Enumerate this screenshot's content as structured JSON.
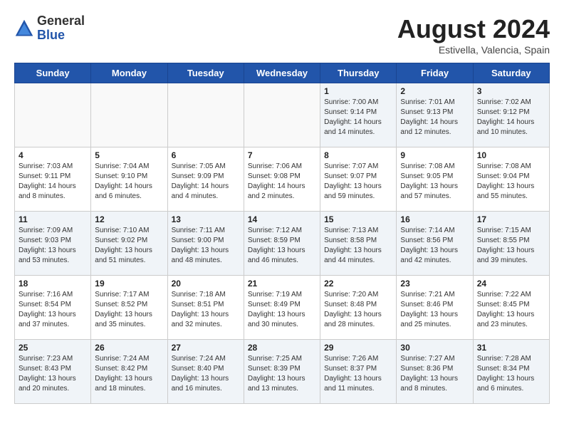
{
  "header": {
    "logo_general": "General",
    "logo_blue": "Blue",
    "month_year": "August 2024",
    "location": "Estivella, Valencia, Spain"
  },
  "days_of_week": [
    "Sunday",
    "Monday",
    "Tuesday",
    "Wednesday",
    "Thursday",
    "Friday",
    "Saturday"
  ],
  "weeks": [
    [
      {
        "day": "",
        "info": ""
      },
      {
        "day": "",
        "info": ""
      },
      {
        "day": "",
        "info": ""
      },
      {
        "day": "",
        "info": ""
      },
      {
        "day": "1",
        "info": "Sunrise: 7:00 AM\nSunset: 9:14 PM\nDaylight: 14 hours\nand 14 minutes."
      },
      {
        "day": "2",
        "info": "Sunrise: 7:01 AM\nSunset: 9:13 PM\nDaylight: 14 hours\nand 12 minutes."
      },
      {
        "day": "3",
        "info": "Sunrise: 7:02 AM\nSunset: 9:12 PM\nDaylight: 14 hours\nand 10 minutes."
      }
    ],
    [
      {
        "day": "4",
        "info": "Sunrise: 7:03 AM\nSunset: 9:11 PM\nDaylight: 14 hours\nand 8 minutes."
      },
      {
        "day": "5",
        "info": "Sunrise: 7:04 AM\nSunset: 9:10 PM\nDaylight: 14 hours\nand 6 minutes."
      },
      {
        "day": "6",
        "info": "Sunrise: 7:05 AM\nSunset: 9:09 PM\nDaylight: 14 hours\nand 4 minutes."
      },
      {
        "day": "7",
        "info": "Sunrise: 7:06 AM\nSunset: 9:08 PM\nDaylight: 14 hours\nand 2 minutes."
      },
      {
        "day": "8",
        "info": "Sunrise: 7:07 AM\nSunset: 9:07 PM\nDaylight: 13 hours\nand 59 minutes."
      },
      {
        "day": "9",
        "info": "Sunrise: 7:08 AM\nSunset: 9:05 PM\nDaylight: 13 hours\nand 57 minutes."
      },
      {
        "day": "10",
        "info": "Sunrise: 7:08 AM\nSunset: 9:04 PM\nDaylight: 13 hours\nand 55 minutes."
      }
    ],
    [
      {
        "day": "11",
        "info": "Sunrise: 7:09 AM\nSunset: 9:03 PM\nDaylight: 13 hours\nand 53 minutes."
      },
      {
        "day": "12",
        "info": "Sunrise: 7:10 AM\nSunset: 9:02 PM\nDaylight: 13 hours\nand 51 minutes."
      },
      {
        "day": "13",
        "info": "Sunrise: 7:11 AM\nSunset: 9:00 PM\nDaylight: 13 hours\nand 48 minutes."
      },
      {
        "day": "14",
        "info": "Sunrise: 7:12 AM\nSunset: 8:59 PM\nDaylight: 13 hours\nand 46 minutes."
      },
      {
        "day": "15",
        "info": "Sunrise: 7:13 AM\nSunset: 8:58 PM\nDaylight: 13 hours\nand 44 minutes."
      },
      {
        "day": "16",
        "info": "Sunrise: 7:14 AM\nSunset: 8:56 PM\nDaylight: 13 hours\nand 42 minutes."
      },
      {
        "day": "17",
        "info": "Sunrise: 7:15 AM\nSunset: 8:55 PM\nDaylight: 13 hours\nand 39 minutes."
      }
    ],
    [
      {
        "day": "18",
        "info": "Sunrise: 7:16 AM\nSunset: 8:54 PM\nDaylight: 13 hours\nand 37 minutes."
      },
      {
        "day": "19",
        "info": "Sunrise: 7:17 AM\nSunset: 8:52 PM\nDaylight: 13 hours\nand 35 minutes."
      },
      {
        "day": "20",
        "info": "Sunrise: 7:18 AM\nSunset: 8:51 PM\nDaylight: 13 hours\nand 32 minutes."
      },
      {
        "day": "21",
        "info": "Sunrise: 7:19 AM\nSunset: 8:49 PM\nDaylight: 13 hours\nand 30 minutes."
      },
      {
        "day": "22",
        "info": "Sunrise: 7:20 AM\nSunset: 8:48 PM\nDaylight: 13 hours\nand 28 minutes."
      },
      {
        "day": "23",
        "info": "Sunrise: 7:21 AM\nSunset: 8:46 PM\nDaylight: 13 hours\nand 25 minutes."
      },
      {
        "day": "24",
        "info": "Sunrise: 7:22 AM\nSunset: 8:45 PM\nDaylight: 13 hours\nand 23 minutes."
      }
    ],
    [
      {
        "day": "25",
        "info": "Sunrise: 7:23 AM\nSunset: 8:43 PM\nDaylight: 13 hours\nand 20 minutes."
      },
      {
        "day": "26",
        "info": "Sunrise: 7:24 AM\nSunset: 8:42 PM\nDaylight: 13 hours\nand 18 minutes."
      },
      {
        "day": "27",
        "info": "Sunrise: 7:24 AM\nSunset: 8:40 PM\nDaylight: 13 hours\nand 16 minutes."
      },
      {
        "day": "28",
        "info": "Sunrise: 7:25 AM\nSunset: 8:39 PM\nDaylight: 13 hours\nand 13 minutes."
      },
      {
        "day": "29",
        "info": "Sunrise: 7:26 AM\nSunset: 8:37 PM\nDaylight: 13 hours\nand 11 minutes."
      },
      {
        "day": "30",
        "info": "Sunrise: 7:27 AM\nSunset: 8:36 PM\nDaylight: 13 hours\nand 8 minutes."
      },
      {
        "day": "31",
        "info": "Sunrise: 7:28 AM\nSunset: 8:34 PM\nDaylight: 13 hours\nand 6 minutes."
      }
    ]
  ]
}
